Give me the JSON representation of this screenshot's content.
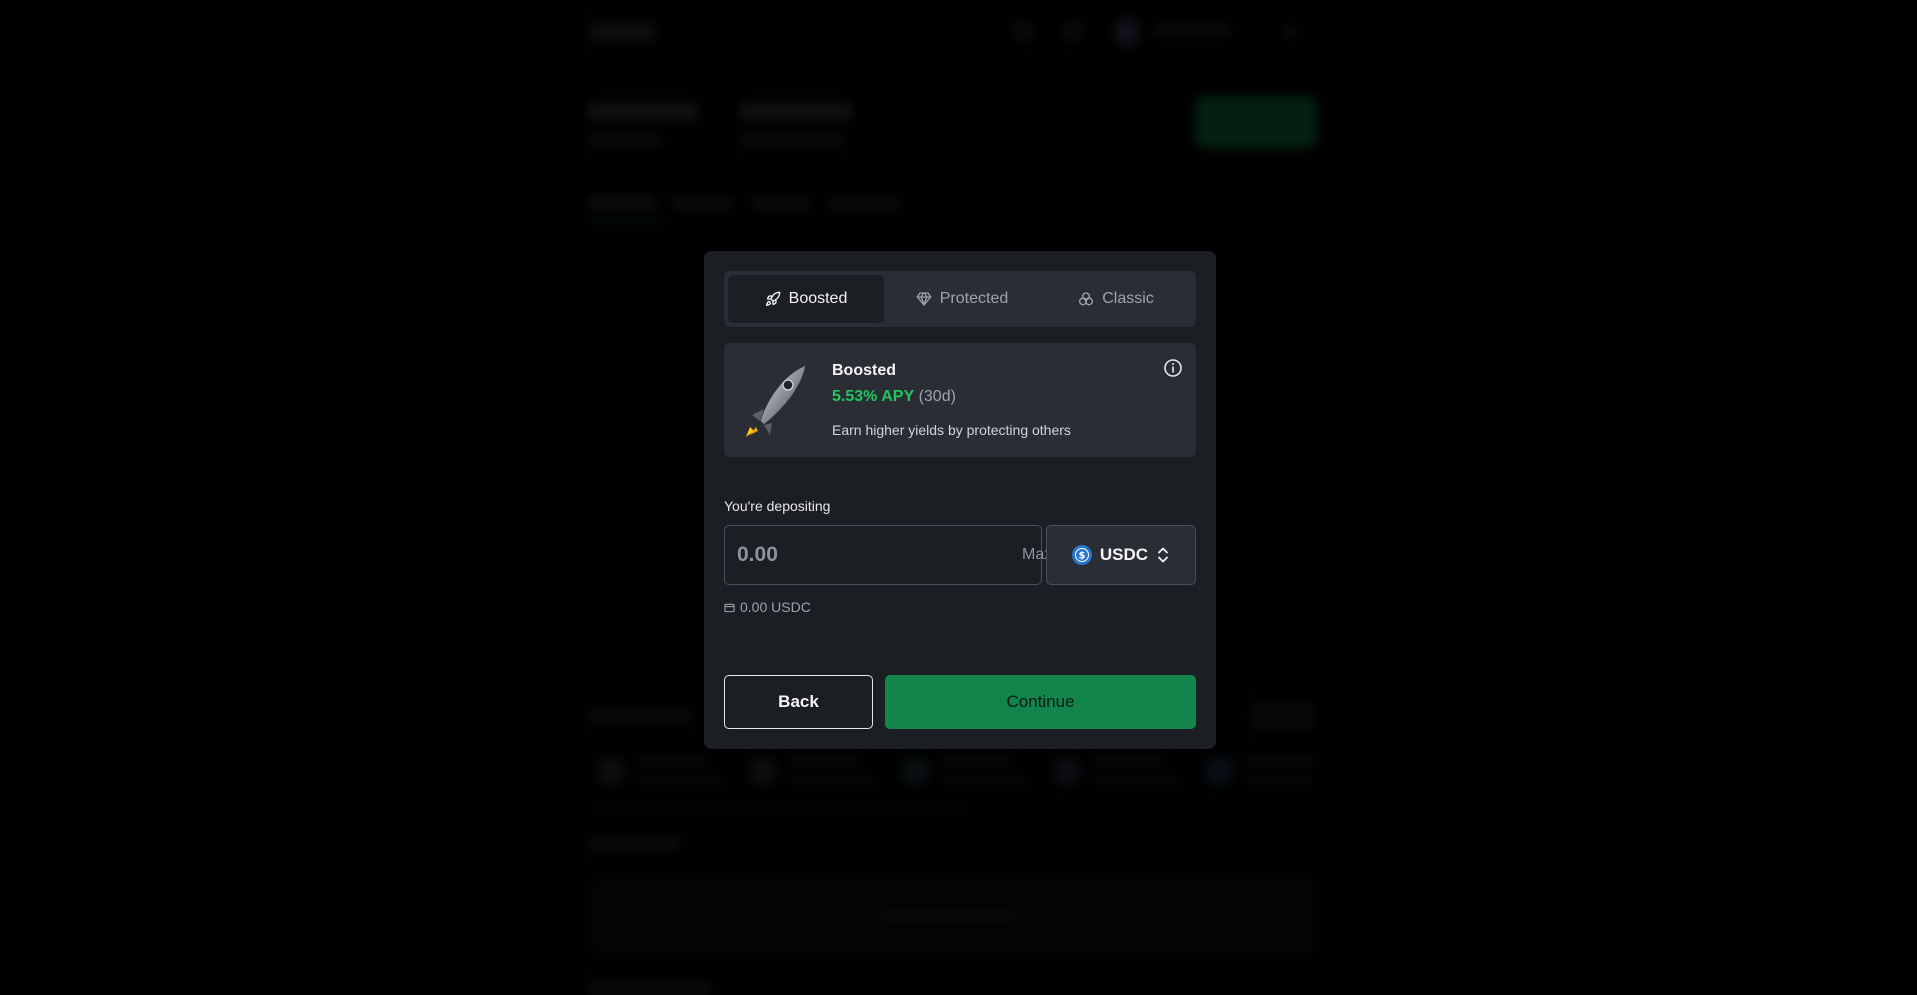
{
  "modal": {
    "tabs": [
      {
        "label": "Boosted",
        "icon": "rocket-icon",
        "active": true
      },
      {
        "label": "Protected",
        "icon": "diamond-icon",
        "active": false
      },
      {
        "label": "Classic",
        "icon": "triple-circles-icon",
        "active": false
      }
    ],
    "card": {
      "title": "Boosted",
      "apy": "5.53% APY",
      "apy_period": "(30d)",
      "description": "Earn higher yields by protecting others"
    },
    "deposit": {
      "label": "You're depositing",
      "amount_placeholder": "0.00",
      "max_label": "Max",
      "token": "USDC",
      "balance": "0.00 USDC"
    },
    "buttons": {
      "back": "Back",
      "continue": "Continue"
    }
  },
  "colors": {
    "accent_green": "#13854c",
    "apy_green": "#22c55e",
    "modal_bg": "#1b1e22",
    "card_bg": "#2a2e34"
  }
}
